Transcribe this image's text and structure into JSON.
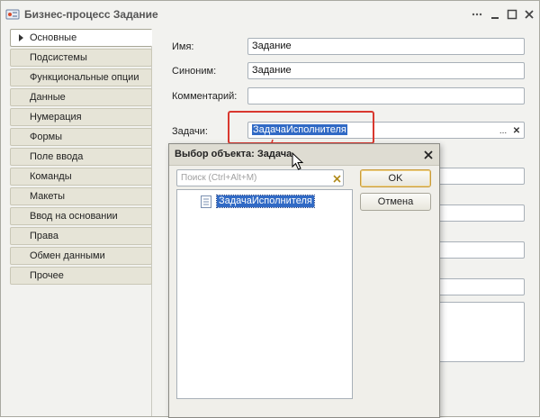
{
  "window": {
    "title": "Бизнес-процесс Задание"
  },
  "nav": {
    "items": [
      {
        "label": "Основные"
      },
      {
        "label": "Подсистемы"
      },
      {
        "label": "Функциональные опции"
      },
      {
        "label": "Данные"
      },
      {
        "label": "Нумерация"
      },
      {
        "label": "Формы"
      },
      {
        "label": "Поле ввода"
      },
      {
        "label": "Команды"
      },
      {
        "label": "Макеты"
      },
      {
        "label": "Ввод на основании"
      },
      {
        "label": "Права"
      },
      {
        "label": "Обмен данными"
      },
      {
        "label": "Прочее"
      }
    ]
  },
  "form": {
    "name_label": "Имя:",
    "name_value": "Задание",
    "synonym_label": "Синоним:",
    "synonym_value": "Задание",
    "comment_label": "Комментарий:",
    "comment_value": "",
    "tasks_label": "Задачи:",
    "tasks_value": "ЗадачаИсполнителя",
    "ellipsis": "...",
    "clear": "✕"
  },
  "dialog": {
    "title": "Выбор объекта: Задача",
    "search_placeholder": "Поиск (Ctrl+Alt+M)",
    "ok_label": "OK",
    "cancel_label": "Отмена",
    "tree_item": "ЗадачаИсполнителя"
  },
  "colors": {
    "selection": "#316ac5",
    "highlight": "#d9382f"
  }
}
